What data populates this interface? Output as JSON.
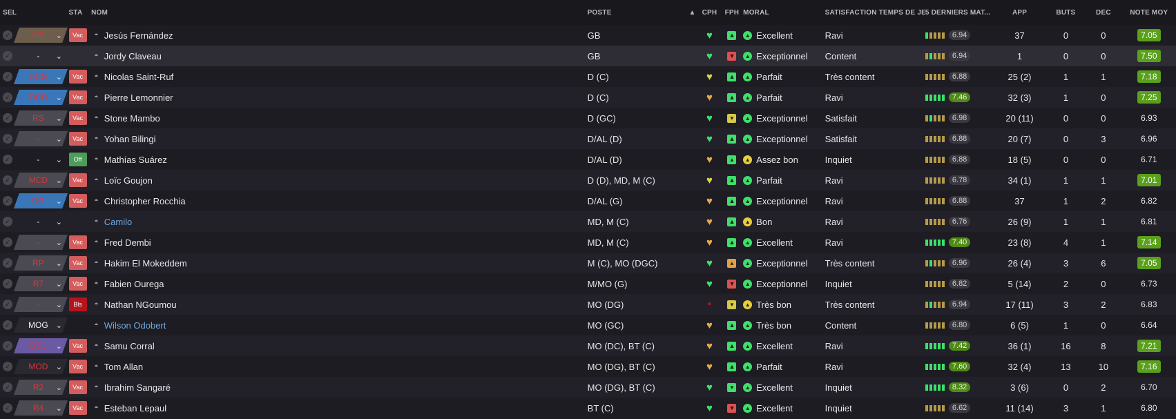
{
  "columns": {
    "sel": "SÉL",
    "sta": "STA",
    "nom": "NOM",
    "poste": "POSTE",
    "cph": "CPH",
    "fph": "FPH",
    "moral": "MORAL",
    "sat": "SATISFACTION TEMPS DE JEU",
    "last5": "5 DERNIERS MAT...",
    "app": "APP",
    "buts": "BUTS",
    "dec": "DÉC",
    "note": "NOTE MOY"
  },
  "sort_indicator": "▲",
  "colors": {
    "heart_green": "#3ee06a",
    "heart_yellow": "#d6d640",
    "heart_orange": "#e7a94a",
    "fph_green": "#3ee06a",
    "fph_red": "#e05050",
    "fph_yellow": "#d6c948",
    "fph_orange": "#e3a040",
    "moral_green": "#3ee06a",
    "moral_yellow": "#e6cf3c",
    "rating_good": "#4f8a18",
    "note_good": "#5aa01d"
  },
  "players": [
    {
      "sel": "GB",
      "sel_style": "tan",
      "sta": "Vac",
      "sta_type": "vac",
      "name": "Jesús Fernández",
      "link": false,
      "poste": "GB",
      "cph": "green",
      "fph": "green",
      "fph_icon": "thumb-up",
      "moral_icon": "green",
      "moral": "Excellent",
      "sat": "Ravi",
      "bars": [
        "g",
        "y",
        "y",
        "y",
        "y"
      ],
      "rating": "6.94",
      "rating_good": false,
      "app": "37",
      "buts": "0",
      "dec": "0",
      "note": "7.05",
      "note_good": true
    },
    {
      "sel": "-",
      "sel_style": "none",
      "sta": "",
      "sta_type": "",
      "name": "Jordy Claveau",
      "link": false,
      "poste": "GB",
      "cph": "green",
      "fph": "red",
      "fph_icon": "thumb-down",
      "moral_icon": "green",
      "moral": "Exceptionnel",
      "sat": "Content",
      "bars": [
        "y",
        "g",
        "y",
        "y",
        "y"
      ],
      "rating": "6.94",
      "rating_good": false,
      "app": "1",
      "buts": "0",
      "dec": "0",
      "note": "7.50",
      "note_good": true
    },
    {
      "sel": "DCG",
      "sel_style": "blue",
      "sta": "Vac",
      "sta_type": "vac",
      "name": "Nicolas Saint-Ruf",
      "link": false,
      "poste": "D (C)",
      "cph": "yellow",
      "fph": "green",
      "fph_icon": "thumb-up",
      "moral_icon": "green",
      "moral": "Parfait",
      "sat": "Très content",
      "bars": [
        "y",
        "y",
        "y",
        "y",
        "y"
      ],
      "rating": "6.88",
      "rating_good": false,
      "app": "25 (2)",
      "buts": "1",
      "dec": "1",
      "note": "7.18",
      "note_good": true
    },
    {
      "sel": "DCD",
      "sel_style": "blue",
      "sta": "Vac",
      "sta_type": "vac",
      "name": "Pierre Lemonnier",
      "link": false,
      "poste": "D (C)",
      "cph": "orange",
      "fph": "green",
      "fph_icon": "thumb-up",
      "moral_icon": "green",
      "moral": "Parfait",
      "sat": "Ravi",
      "bars": [
        "g",
        "g",
        "g",
        "g",
        "g"
      ],
      "rating": "7.46",
      "rating_good": true,
      "app": "32 (3)",
      "buts": "1",
      "dec": "0",
      "note": "7.25",
      "note_good": true
    },
    {
      "sel": "RS",
      "sel_style": "gray",
      "sta": "Vac",
      "sta_type": "vac",
      "name": "Stone Mambo",
      "link": false,
      "poste": "D (GC)",
      "cph": "green",
      "fph": "yellow",
      "fph_icon": "chevron",
      "moral_icon": "green",
      "moral": "Exceptionnel",
      "sat": "Satisfait",
      "bars": [
        "y",
        "g",
        "y",
        "y",
        "y"
      ],
      "rating": "6.98",
      "rating_good": false,
      "app": "20 (11)",
      "buts": "0",
      "dec": "0",
      "note": "6.93",
      "note_good": false
    },
    {
      "sel": "-",
      "sel_style": "gray",
      "sta": "Vac",
      "sta_type": "vac",
      "name": "Yohan Bilingi",
      "link": false,
      "poste": "D/AL (D)",
      "cph": "green",
      "fph": "green",
      "fph_icon": "thumb-up",
      "moral_icon": "green",
      "moral": "Exceptionnel",
      "sat": "Satisfait",
      "bars": [
        "y",
        "y",
        "y",
        "y",
        "y"
      ],
      "rating": "6.88",
      "rating_good": false,
      "app": "20 (7)",
      "buts": "0",
      "dec": "3",
      "note": "6.96",
      "note_good": false
    },
    {
      "sel": "-",
      "sel_style": "none",
      "sta": "Off",
      "sta_type": "off",
      "name": "Mathías Suárez",
      "link": false,
      "poste": "D/AL (D)",
      "cph": "orange",
      "fph": "green",
      "fph_icon": "chevron-up",
      "moral_icon": "yellow",
      "moral": "Assez bon",
      "sat": "Inquiet",
      "bars": [
        "y",
        "y",
        "y",
        "y",
        "y"
      ],
      "rating": "6.88",
      "rating_good": false,
      "app": "18 (5)",
      "buts": "0",
      "dec": "0",
      "note": "6.71",
      "note_good": false
    },
    {
      "sel": "MCD",
      "sel_style": "gray",
      "sta": "Vac",
      "sta_type": "vac",
      "name": "Loïc Goujon",
      "link": false,
      "poste": "D (D), MD, M (C)",
      "cph": "yellow",
      "fph": "green",
      "fph_icon": "thumb-up",
      "moral_icon": "green",
      "moral": "Parfait",
      "sat": "Ravi",
      "bars": [
        "y",
        "y",
        "y",
        "y",
        "y"
      ],
      "rating": "6.78",
      "rating_good": false,
      "app": "34 (1)",
      "buts": "1",
      "dec": "1",
      "note": "7.01",
      "note_good": true
    },
    {
      "sel": "DG",
      "sel_style": "blue",
      "sta": "Vac",
      "sta_type": "vac",
      "name": "Christopher Rocchia",
      "link": false,
      "poste": "D/AL (G)",
      "cph": "orange",
      "fph": "green",
      "fph_icon": "thumb-up",
      "moral_icon": "green",
      "moral": "Exceptionnel",
      "sat": "Ravi",
      "bars": [
        "y",
        "y",
        "y",
        "y",
        "y"
      ],
      "rating": "6.88",
      "rating_good": false,
      "app": "37",
      "buts": "1",
      "dec": "2",
      "note": "6.82",
      "note_good": false
    },
    {
      "sel": "-",
      "sel_style": "none",
      "sta": "",
      "sta_type": "",
      "name": "Camilo",
      "link": true,
      "poste": "MD, M (C)",
      "cph": "orange",
      "fph": "green",
      "fph_icon": "thumb-up",
      "moral_icon": "yellow",
      "moral": "Bon",
      "sat": "Ravi",
      "bars": [
        "y",
        "y",
        "y",
        "y",
        "y"
      ],
      "rating": "6.76",
      "rating_good": false,
      "app": "26 (9)",
      "buts": "1",
      "dec": "1",
      "note": "6.81",
      "note_good": false
    },
    {
      "sel": "-",
      "sel_style": "gray",
      "sta": "Vac",
      "sta_type": "vac",
      "name": "Fred Dembi",
      "link": false,
      "poste": "MD, M (C)",
      "cph": "orange",
      "fph": "green",
      "fph_icon": "thumb-up",
      "moral_icon": "green",
      "moral": "Excellent",
      "sat": "Ravi",
      "bars": [
        "g",
        "g",
        "g",
        "g",
        "g"
      ],
      "rating": "7.40",
      "rating_good": true,
      "app": "23 (8)",
      "buts": "4",
      "dec": "1",
      "note": "7.14",
      "note_good": true
    },
    {
      "sel": "RP",
      "sel_style": "gray",
      "sta": "Vac",
      "sta_type": "vac",
      "name": "Hakim El Mokeddem",
      "link": false,
      "poste": "M (C), MO (DGC)",
      "cph": "green",
      "fph": "orange",
      "fph_icon": "chevron-up",
      "moral_icon": "green",
      "moral": "Exceptionnel",
      "sat": "Très content",
      "bars": [
        "y",
        "g",
        "y",
        "y",
        "y"
      ],
      "rating": "6.96",
      "rating_good": false,
      "app": "26 (4)",
      "buts": "3",
      "dec": "6",
      "note": "7.05",
      "note_good": true
    },
    {
      "sel": "R7",
      "sel_style": "gray",
      "sta": "Vac",
      "sta_type": "vac",
      "name": "Fabien Ourega",
      "link": false,
      "poste": "M/MO (G)",
      "cph": "green",
      "fph": "red",
      "fph_icon": "thumb-down",
      "moral_icon": "green",
      "moral": "Exceptionnel",
      "sat": "Inquiet",
      "bars": [
        "y",
        "y",
        "y",
        "y",
        "y"
      ],
      "rating": "6.82",
      "rating_good": false,
      "app": "5 (14)",
      "buts": "2",
      "dec": "0",
      "note": "6.73",
      "note_good": false
    },
    {
      "sel": "-",
      "sel_style": "gray",
      "sta": "Bls",
      "sta_type": "bls",
      "name": "Nathan NGoumou",
      "link": false,
      "poste": "MO (DG)",
      "cph": "injury",
      "fph": "yellow",
      "fph_icon": "chevron",
      "moral_icon": "yellow",
      "moral": "Très bon",
      "sat": "Très content",
      "bars": [
        "y",
        "g",
        "y",
        "y",
        "y"
      ],
      "rating": "6.94",
      "rating_good": false,
      "app": "17 (11)",
      "buts": "3",
      "dec": "2",
      "note": "6.83",
      "note_good": false
    },
    {
      "sel": "MOG",
      "sel_style": "dark",
      "sel_white": true,
      "sta": "",
      "sta_type": "",
      "name": "Wilson Odobert",
      "link": true,
      "poste": "MO (GC)",
      "cph": "orange",
      "fph": "green",
      "fph_icon": "thumb-up",
      "moral_icon": "green",
      "moral": "Très bon",
      "sat": "Content",
      "bars": [
        "y",
        "y",
        "y",
        "y",
        "y"
      ],
      "rating": "6.80",
      "rating_good": false,
      "app": "6 (5)",
      "buts": "1",
      "dec": "0",
      "note": "6.64",
      "note_good": false
    },
    {
      "sel": "BTC",
      "sel_style": "purple",
      "sta": "Vac",
      "sta_type": "vac",
      "name": "Samu Corral",
      "link": false,
      "poste": "MO (DC), BT (C)",
      "cph": "orange",
      "fph": "green",
      "fph_icon": "thumb-up",
      "moral_icon": "green",
      "moral": "Excellent",
      "sat": "Ravi",
      "bars": [
        "g",
        "g",
        "g",
        "g",
        "g"
      ],
      "rating": "7.42",
      "rating_good": true,
      "app": "36 (1)",
      "buts": "16",
      "dec": "8",
      "note": "7.21",
      "note_good": true
    },
    {
      "sel": "MOD",
      "sel_style": "dark",
      "sta": "Vac",
      "sta_type": "vac",
      "name": "Tom Allan",
      "link": false,
      "poste": "MO (DG), BT (C)",
      "cph": "orange",
      "fph": "green",
      "fph_icon": "thumb-up",
      "moral_icon": "green",
      "moral": "Parfait",
      "sat": "Ravi",
      "bars": [
        "g",
        "g",
        "g",
        "g",
        "g"
      ],
      "rating": "7.60",
      "rating_good": true,
      "app": "32 (4)",
      "buts": "13",
      "dec": "10",
      "note": "7.16",
      "note_good": true
    },
    {
      "sel": "R2",
      "sel_style": "gray",
      "sta": "Vac",
      "sta_type": "vac",
      "name": "Ibrahim Sangaré",
      "link": false,
      "poste": "MO (DG), BT (C)",
      "cph": "green",
      "fph": "green",
      "fph_icon": "chevron",
      "moral_icon": "green",
      "moral": "Excellent",
      "sat": "Inquiet",
      "bars": [
        "g",
        "g",
        "g",
        "g",
        "g"
      ],
      "rating": "8.32",
      "rating_good": true,
      "app": "3 (6)",
      "buts": "0",
      "dec": "2",
      "note": "6.70",
      "note_good": false
    },
    {
      "sel": "R4",
      "sel_style": "gray",
      "sta": "Vac",
      "sta_type": "vac",
      "name": "Esteban Lepaul",
      "link": false,
      "poste": "BT (C)",
      "cph": "green",
      "fph": "red",
      "fph_icon": "thumb-down",
      "moral_icon": "green",
      "moral": "Excellent",
      "sat": "Inquiet",
      "bars": [
        "y",
        "y",
        "y",
        "y",
        "y"
      ],
      "rating": "6.62",
      "rating_good": false,
      "app": "11 (14)",
      "buts": "3",
      "dec": "1",
      "note": "6.80",
      "note_good": false
    }
  ]
}
